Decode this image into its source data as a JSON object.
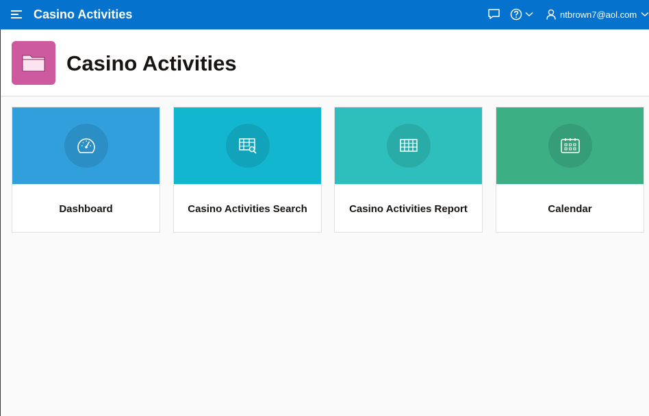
{
  "header": {
    "app_title": "Casino Activities",
    "user": "ntbrown7@aol.com",
    "icons": [
      "menu-icon",
      "chat-icon",
      "help-icon",
      "chevron-down-icon",
      "user-icon",
      "chevron-down-icon"
    ],
    "background_color": "#0572ce"
  },
  "hero": {
    "title": "Casino Activities",
    "icon": "folder-icon",
    "icon_color": "#cd5a9e"
  },
  "cards": [
    {
      "label": "Dashboard",
      "icon": "gauge-icon",
      "color": "#309fdb"
    },
    {
      "label": "Casino Activities Search",
      "icon": "table-search-icon",
      "color": "#13b6cf"
    },
    {
      "label": "Casino Activities Report",
      "icon": "table-icon",
      "color": "#2ebfbc"
    },
    {
      "label": "Calendar",
      "icon": "calendar-icon",
      "color": "#3caf85"
    }
  ]
}
